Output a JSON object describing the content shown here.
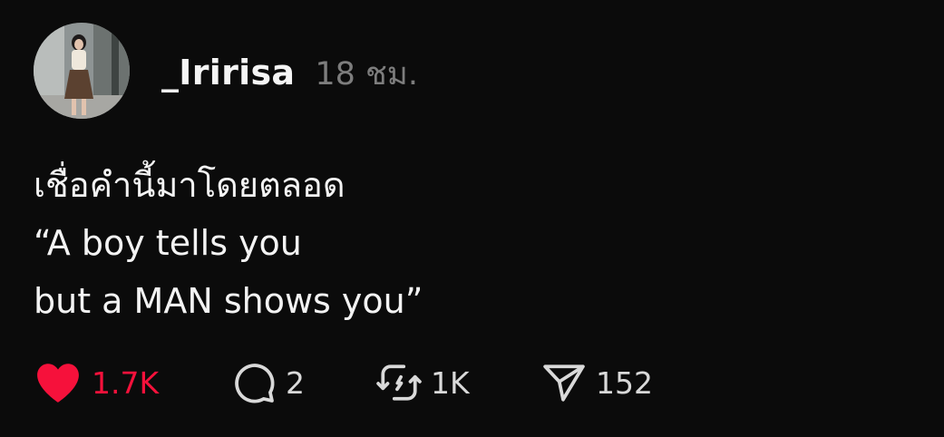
{
  "post": {
    "username": "_Iririsa",
    "time": "18 ชม.",
    "lines": [
      "เชื่อคำนี้มาโดยตลอด",
      "“A boy tells you",
      "but a MAN shows you”"
    ]
  },
  "actions": {
    "likes": "1.7K",
    "replies": "2",
    "reposts": "1K",
    "shares": "152"
  },
  "colors": {
    "like_accent": "#f6113b",
    "background": "#0b0b0b",
    "muted": "#7d7d7d"
  },
  "icons": [
    "heart-icon",
    "comment-icon",
    "repost-icon",
    "share-icon"
  ]
}
